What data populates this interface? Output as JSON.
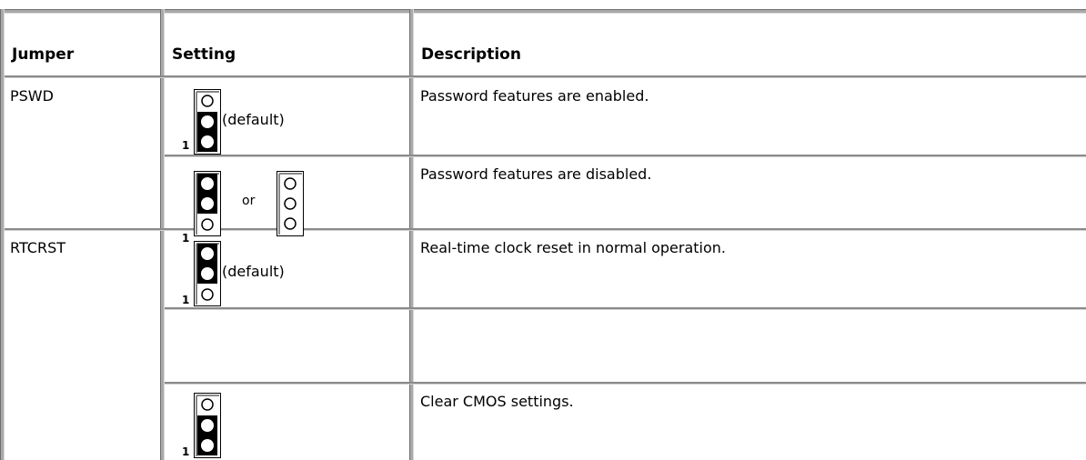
{
  "table": {
    "headers": {
      "jumper": "Jumper",
      "setting": "Setting",
      "description": "Description"
    },
    "pin_label": "1",
    "rows": [
      {
        "jumper": "PSWD",
        "setting_text": "(default)",
        "description": "Password features are enabled."
      },
      {
        "jumper": "",
        "setting_text": "or",
        "description": "Password features are disabled."
      },
      {
        "jumper": "RTCRST",
        "setting_text": "(default)",
        "description": "Real-time clock reset in normal operation."
      },
      {
        "jumper": "",
        "setting_text": "",
        "description": "Clear CMOS settings."
      }
    ]
  }
}
